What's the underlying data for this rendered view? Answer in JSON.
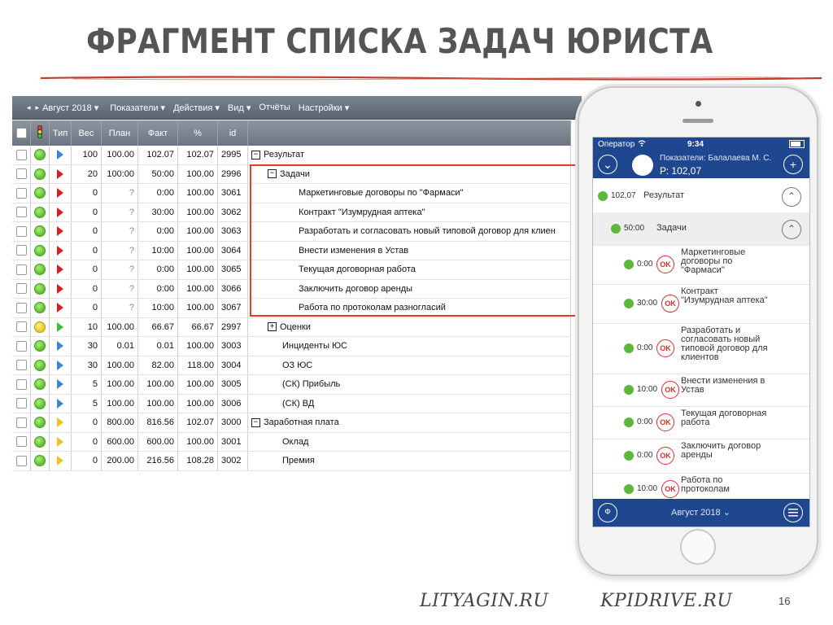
{
  "slide": {
    "title": "ФРАГМЕНТ СПИСКА  ЗАДАЧ ЮРИСТА",
    "links": [
      "LITYAGIN.RU",
      "KPIDRIVE.RU"
    ],
    "page_number": "16"
  },
  "desktop": {
    "toolbar": {
      "nav_prev": "◂",
      "nav_next": "▸",
      "month": "Август 2018 ▾",
      "menus": [
        "Показатели ▾",
        "Действия ▾",
        "Вид ▾",
        "Отчёты",
        "Настройки ▾"
      ]
    },
    "columns": [
      "",
      "",
      "Тип",
      "Вес",
      "План",
      "Факт",
      "%",
      "id",
      ""
    ],
    "rows": [
      {
        "status": "green",
        "type": "blue",
        "weight": "100",
        "plan": "100.00",
        "fact": "102.07",
        "pct": "102.07",
        "id": "2995",
        "tree": "minus",
        "level": 0,
        "name": "Результат"
      },
      {
        "status": "green",
        "type": "red",
        "weight": "20",
        "plan": "100:00",
        "fact": "50:00",
        "pct": "100.00",
        "id": "2996",
        "tree": "minus",
        "level": 1,
        "name": "Задачи"
      },
      {
        "status": "green",
        "type": "red",
        "weight": "0",
        "plan": "?",
        "fact": "0:00",
        "pct": "100.00",
        "id": "3061",
        "tree": "",
        "level": 2,
        "name": "Маркетинговые договоры по \"Фармаси\""
      },
      {
        "status": "green",
        "type": "red",
        "weight": "0",
        "plan": "?",
        "fact": "30:00",
        "pct": "100.00",
        "id": "3062",
        "tree": "",
        "level": 2,
        "name": "Контракт \"Изумрудная аптека\""
      },
      {
        "status": "green",
        "type": "red",
        "weight": "0",
        "plan": "?",
        "fact": "0:00",
        "pct": "100.00",
        "id": "3063",
        "tree": "",
        "level": 2,
        "name": "Разработать и согласовать новый типовой договор для клиен"
      },
      {
        "status": "green",
        "type": "red",
        "weight": "0",
        "plan": "?",
        "fact": "10:00",
        "pct": "100.00",
        "id": "3064",
        "tree": "",
        "level": 2,
        "name": "Внести изменения в Устав"
      },
      {
        "status": "green",
        "type": "red",
        "weight": "0",
        "plan": "?",
        "fact": "0:00",
        "pct": "100.00",
        "id": "3065",
        "tree": "",
        "level": 2,
        "name": "Текущая договорная работа"
      },
      {
        "status": "green",
        "type": "red",
        "weight": "0",
        "plan": "?",
        "fact": "0:00",
        "pct": "100.00",
        "id": "3066",
        "tree": "",
        "level": 2,
        "name": "Заключить договор аренды"
      },
      {
        "status": "green",
        "type": "red",
        "weight": "0",
        "plan": "?",
        "fact": "10:00",
        "pct": "100.00",
        "id": "3067",
        "tree": "",
        "level": 2,
        "name": "Работа по протоколам разногласий"
      },
      {
        "status": "yellow",
        "type": "green",
        "weight": "10",
        "plan": "100.00",
        "fact": "66.67",
        "pct": "66.67",
        "id": "2997",
        "tree": "plus",
        "level": 1,
        "name": "Оценки"
      },
      {
        "status": "green",
        "type": "blue",
        "weight": "30",
        "plan": "0.01",
        "fact": "0.01",
        "pct": "100.00",
        "id": "3003",
        "tree": "",
        "level": 3,
        "name": "Инциденты ЮС"
      },
      {
        "status": "green",
        "type": "blue",
        "weight": "30",
        "plan": "100.00",
        "fact": "82.00",
        "pct": "118.00",
        "id": "3004",
        "tree": "",
        "level": 3,
        "name": "ОЗ ЮС"
      },
      {
        "status": "green",
        "type": "blue",
        "weight": "5",
        "plan": "100.00",
        "fact": "100.00",
        "pct": "100.00",
        "id": "3005",
        "tree": "",
        "level": 3,
        "name": "(СК) Прибыль"
      },
      {
        "status": "green",
        "type": "blue",
        "weight": "5",
        "plan": "100.00",
        "fact": "100.00",
        "pct": "100.00",
        "id": "3006",
        "tree": "",
        "level": 3,
        "name": "(СК) ВД"
      },
      {
        "status": "green",
        "type": "yellow",
        "weight": "0",
        "plan": "800.00",
        "fact": "816.56",
        "pct": "102.07",
        "id": "3000",
        "tree": "minus",
        "level": 0,
        "name": "Заработная плата"
      },
      {
        "status": "green",
        "type": "yellow",
        "weight": "0",
        "plan": "600.00",
        "fact": "600.00",
        "pct": "100.00",
        "id": "3001",
        "tree": "",
        "level": 3,
        "name": "Оклад"
      },
      {
        "status": "green",
        "type": "yellow",
        "weight": "0",
        "plan": "200.00",
        "fact": "216.56",
        "pct": "108.28",
        "id": "3002",
        "tree": "",
        "level": 3,
        "name": "Премия"
      }
    ]
  },
  "mobile": {
    "status_bar": {
      "carrier": "Оператор",
      "time": "9:34"
    },
    "header": {
      "line1": "Показатели: Балалаева М. С.",
      "line2": "Р: 102,07"
    },
    "items": [
      {
        "value": "102,07",
        "name": "Результат",
        "type": "group",
        "chevron": "⌃"
      },
      {
        "value": "50:00",
        "name": "Задачи",
        "type": "subgroup",
        "chevron": "⌃"
      },
      {
        "value": "0:00",
        "name": "Маркетинговые договоры по \"Фармаси\"",
        "type": "task",
        "ok": "OK"
      },
      {
        "value": "30:00",
        "name": "Контракт \"Изумрудная аптека\"",
        "type": "task",
        "ok": "OK"
      },
      {
        "value": "0:00",
        "name": "Разработать и согласовать новый типовой договор для клиентов",
        "type": "task",
        "ok": "OK"
      },
      {
        "value": "10:00",
        "name": "Внести изменения в Устав",
        "type": "task",
        "ok": "OK"
      },
      {
        "value": "0:00",
        "name": "Текущая договорная работа",
        "type": "task",
        "ok": "OK"
      },
      {
        "value": "0:00",
        "name": "Заключить договор аренды",
        "type": "task",
        "ok": "OK"
      },
      {
        "value": "10:00",
        "name": "Работа по протоколам",
        "type": "task",
        "ok": "OK"
      }
    ],
    "footer": {
      "month": "Август 2018 ⌄",
      "left_icon": "Ф"
    }
  },
  "colors": {
    "brand_blue": "#1f4790",
    "accent_red": "#e02a2a",
    "ok_green": "#5cb83a"
  }
}
